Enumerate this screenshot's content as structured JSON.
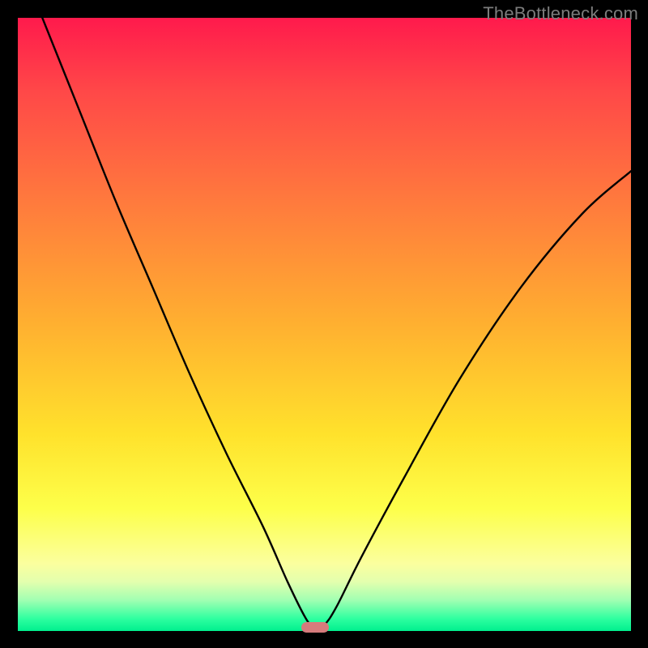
{
  "watermark": "TheBottleneck.com",
  "colors": {
    "page_bg": "#000000",
    "curve_stroke": "#000000",
    "marker_fill": "#d67b7c",
    "gradient_top": "#ff1a4c",
    "gradient_bottom": "#00ef8e"
  },
  "chart_data": {
    "type": "line",
    "title": "",
    "xlabel": "",
    "ylabel": "",
    "xlim": [
      0,
      100
    ],
    "ylim": [
      0,
      100
    ],
    "grid": false,
    "legend": null,
    "series": [
      {
        "name": "bottleneck-curve",
        "x": [
          4,
          10,
          16,
          22,
          28,
          34,
          40,
          44,
          47,
          48.5,
          50,
          52,
          56,
          63,
          72,
          82,
          92,
          100
        ],
        "values": [
          100,
          85,
          70,
          56,
          42,
          29,
          17,
          8,
          2,
          0.5,
          1,
          4,
          12,
          25,
          41,
          56,
          68,
          75
        ]
      }
    ],
    "marker": {
      "x": 48.5,
      "width": 4.5,
      "color": "#d67b7c"
    }
  }
}
